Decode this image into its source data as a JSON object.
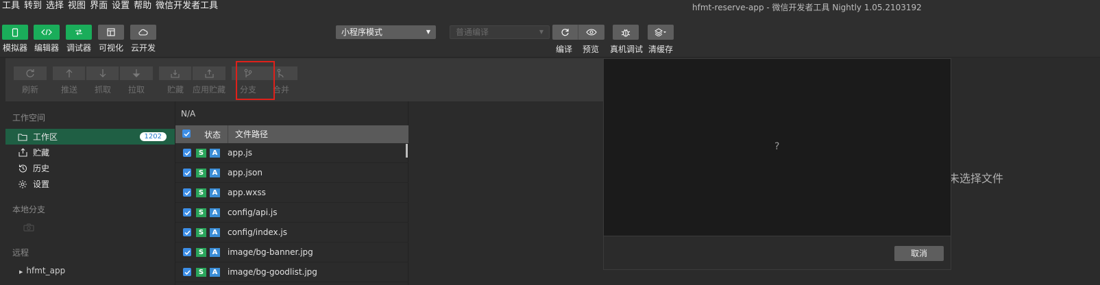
{
  "menu": [
    "工具",
    "转到",
    "选择",
    "视图",
    "界面",
    "设置",
    "帮助",
    "微信开发者工具"
  ],
  "window_title": "hfmt-reserve-app - 微信开发者工具 Nightly 1.05.2103192",
  "toolbar": {
    "left_tools": [
      {
        "label": "模拟器",
        "icon": "phone-icon",
        "style": "green"
      },
      {
        "label": "编辑器",
        "icon": "code-icon",
        "style": "green"
      },
      {
        "label": "调试器",
        "icon": "debug-icon",
        "style": "green"
      },
      {
        "label": "可视化",
        "icon": "layout-icon",
        "style": "gray"
      },
      {
        "label": "云开发",
        "icon": "cloud-icon",
        "style": "gray"
      }
    ],
    "mode_select": "小程序模式",
    "compile_select_placeholder": "普通编译",
    "right_labels": {
      "compile": "编译",
      "preview": "预览",
      "real_debug": "真机调试",
      "clear_cache": "清缓存"
    }
  },
  "git": {
    "tools": [
      {
        "label": "刷新",
        "icon": "refresh-icon"
      },
      {
        "label": "推送",
        "icon": "push-icon"
      },
      {
        "label": "抓取",
        "icon": "fetch-icon"
      },
      {
        "label": "拉取",
        "icon": "pull-icon"
      },
      {
        "label": "贮藏",
        "icon": "stash-icon"
      },
      {
        "label": "应用贮藏",
        "icon": "apply-stash-icon"
      },
      {
        "label": "分支",
        "icon": "branch-icon"
      },
      {
        "label": "合并",
        "icon": "merge-icon"
      }
    ],
    "sidebar": {
      "workspace_title": "工作空间",
      "items": [
        {
          "label": "工作区",
          "icon": "folder-icon",
          "badge": "1202",
          "active": true
        },
        {
          "label": "贮藏",
          "icon": "stash-icon"
        },
        {
          "label": "历史",
          "icon": "history-icon"
        },
        {
          "label": "设置",
          "icon": "gear-icon"
        }
      ],
      "local_branch_title": "本地分支",
      "remote_title": "远程",
      "remote_items": [
        "hfmt_app"
      ]
    },
    "files": {
      "branch": "N/A",
      "headers": {
        "status": "状态",
        "path": "文件路径"
      },
      "rows": [
        {
          "path": "app.js"
        },
        {
          "path": "app.json"
        },
        {
          "path": "app.wxss"
        },
        {
          "path": "config/api.js"
        },
        {
          "path": "config/index.js"
        },
        {
          "path": "image/bg-banner.jpg"
        },
        {
          "path": "image/bg-goodlist.jpg"
        }
      ],
      "tag_s": "S",
      "tag_a": "A"
    },
    "empty_hint": "未选择文件"
  },
  "modal": {
    "body": "?",
    "cancel": "取消"
  },
  "colors": {
    "accent_green": "#1aad5a",
    "active_row": "#1f5f44",
    "highlight": "#e0201a",
    "checkbox": "#3d8ee6"
  }
}
